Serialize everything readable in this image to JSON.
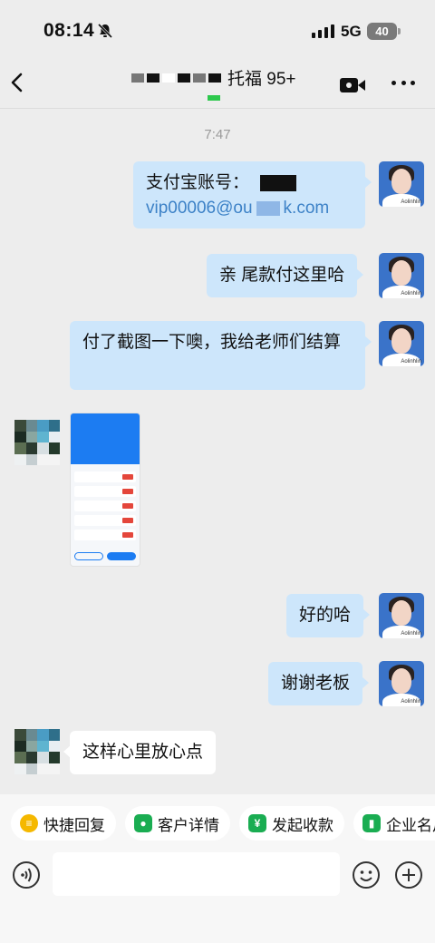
{
  "status_bar": {
    "time": "08:14",
    "network": "5G",
    "battery": "40"
  },
  "header": {
    "title": "托福 95+"
  },
  "chat": {
    "timestamp": "7:47",
    "messages": [
      {
        "side": "right",
        "line1": "支付宝账号：",
        "line2": "vip00006@ou",
        "line2_tail": "k.com"
      },
      {
        "side": "right",
        "text": "亲 尾款付这里哈"
      },
      {
        "side": "right",
        "text": "付了截图一下噢，我给老师们结算"
      },
      {
        "side": "left",
        "type": "image"
      },
      {
        "side": "right",
        "text": "好的哈"
      },
      {
        "side": "right",
        "text": "谢谢老板"
      },
      {
        "side": "left",
        "text": "这样心里放心点"
      }
    ]
  },
  "quick_actions": [
    {
      "label": "快捷回复",
      "icon": "chat-bubble-icon",
      "color": "#f5b800"
    },
    {
      "label": "客户详情",
      "icon": "person-icon",
      "color": "#1aad52"
    },
    {
      "label": "发起收款",
      "icon": "yen-shield-icon",
      "color": "#1aad52"
    },
    {
      "label": "企业名片",
      "icon": "card-icon",
      "color": "#1aad52"
    }
  ],
  "input": {
    "placeholder": ""
  },
  "colors": {
    "bubble_self": "#cde6fb",
    "bubble_other": "#ffffff",
    "link": "#3d82c7",
    "background": "#ededed"
  }
}
